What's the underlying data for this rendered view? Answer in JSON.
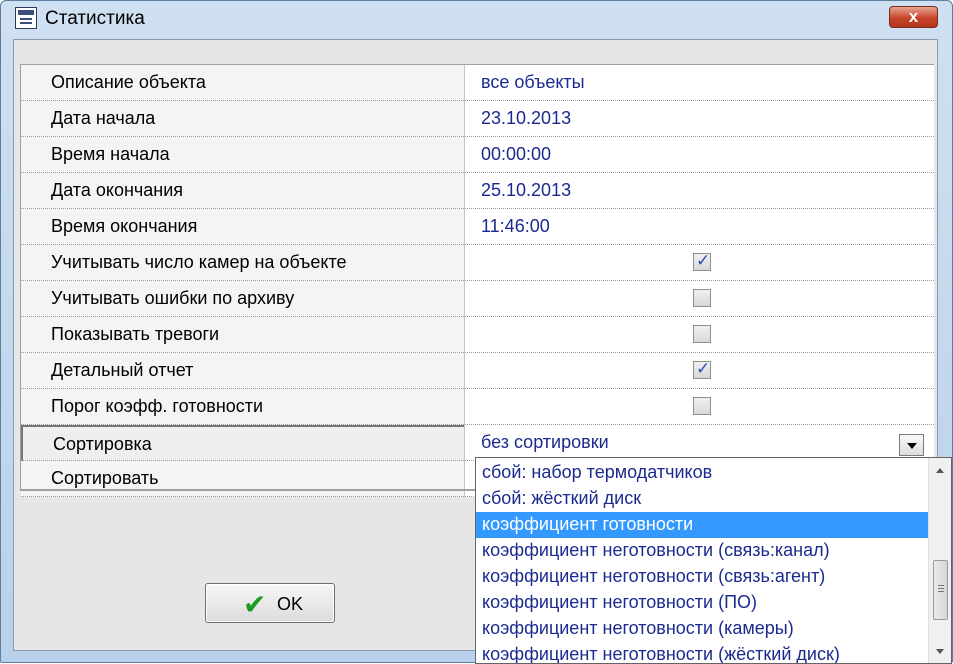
{
  "window": {
    "title": "Статистика",
    "close_label": "x"
  },
  "properties": [
    {
      "label": "Описание объекта",
      "value": "все объекты"
    },
    {
      "label": "Дата начала",
      "value": "23.10.2013"
    },
    {
      "label": "Время начала",
      "value": "00:00:00"
    },
    {
      "label": "Дата окончания",
      "value": "25.10.2013"
    },
    {
      "label": "Время окончания",
      "value": "11:46:00"
    },
    {
      "label": "Учитывать число камер на объекте",
      "checked": true
    },
    {
      "label": "Учитывать ошибки по архиву",
      "checked": false
    },
    {
      "label": "Показывать тревоги",
      "checked": false
    },
    {
      "label": "Детальный отчет",
      "checked": true
    },
    {
      "label": "Порог коэфф. готовности",
      "checked": false
    },
    {
      "label": "Сортировка",
      "value": "без сортировки"
    },
    {
      "label": "Сортировать",
      "value": ""
    }
  ],
  "dropdown": {
    "options": [
      "сбой: набор термодатчиков",
      "сбой: жёсткий диск",
      "коэффициент готовности",
      "коэффициент неготовности (связь:канал)",
      "коэффициент неготовности (связь:агент)",
      "коэффициент неготовности (ПО)",
      "коэффициент неготовности (камеры)",
      "коэффициент неготовности (жёсткий диск)"
    ],
    "selected": "коэффициент готовности"
  },
  "buttons": {
    "ok_label": "OK"
  },
  "colors": {
    "value_text": "#1b2a8f",
    "selection": "#3399ff",
    "close_button": "#c8452c",
    "ok_check": "#1f9a1f"
  }
}
